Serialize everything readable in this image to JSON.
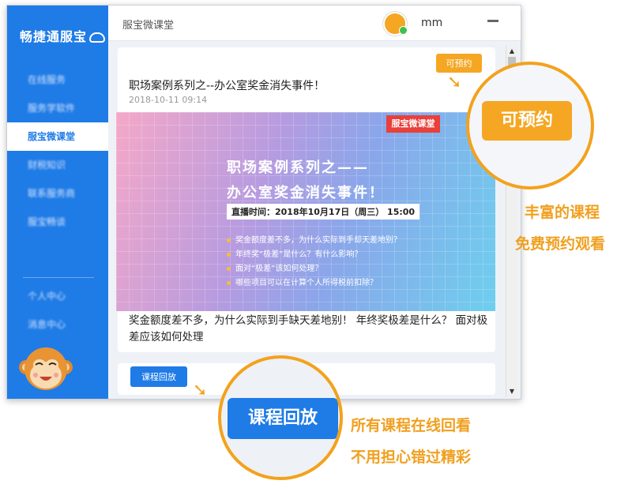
{
  "sidebar": {
    "logo": "畅捷通服宝",
    "items": [
      {
        "label": "在线服务"
      },
      {
        "label": "服务学软件"
      },
      {
        "label": "服宝微课堂"
      },
      {
        "label": "财税知识"
      },
      {
        "label": "联系服务商"
      },
      {
        "label": "服宝畅谈"
      }
    ],
    "bottom_items": [
      {
        "label": "个人中心"
      },
      {
        "label": "消息中心"
      }
    ]
  },
  "header": {
    "title": "服宝微课堂",
    "username": "mm"
  },
  "course": {
    "reserve_label": "可预约",
    "title": "职场案例系列之--办公室奖金消失事件！",
    "date": "2018-10-11 09:14",
    "banner": {
      "tag": "服宝微课堂",
      "line1": "职场案例系列之——",
      "line2": "办公室奖金消失事件！",
      "time": "直播时间：2018年10月17日（周三） 15:00",
      "bullets": [
        "奖金额度差不多，为什么实际到手却天差地别？",
        "年终奖“极差”是什么？有什么影响？",
        "面对“极差”该如何处理？",
        "哪些项目可以在计算个人所得税前扣除？"
      ]
    },
    "description": "奖金额度差不多，为什么实际到手缺天差地别！ 年终奖极差是什么？ 面对极差应该如何处理"
  },
  "replay_label": "课程回放",
  "annotations": {
    "zoom_reserve": "可预约",
    "zoom_replay": "课程回放",
    "callout_right": [
      "丰富的课程",
      "免费预约观看"
    ],
    "callout_bottom": [
      "所有课程在线回看",
      "不用担心错过精彩"
    ]
  },
  "colors": {
    "primary": "#1f7be6",
    "accent": "#f5a623",
    "callout": "#f0a020"
  }
}
